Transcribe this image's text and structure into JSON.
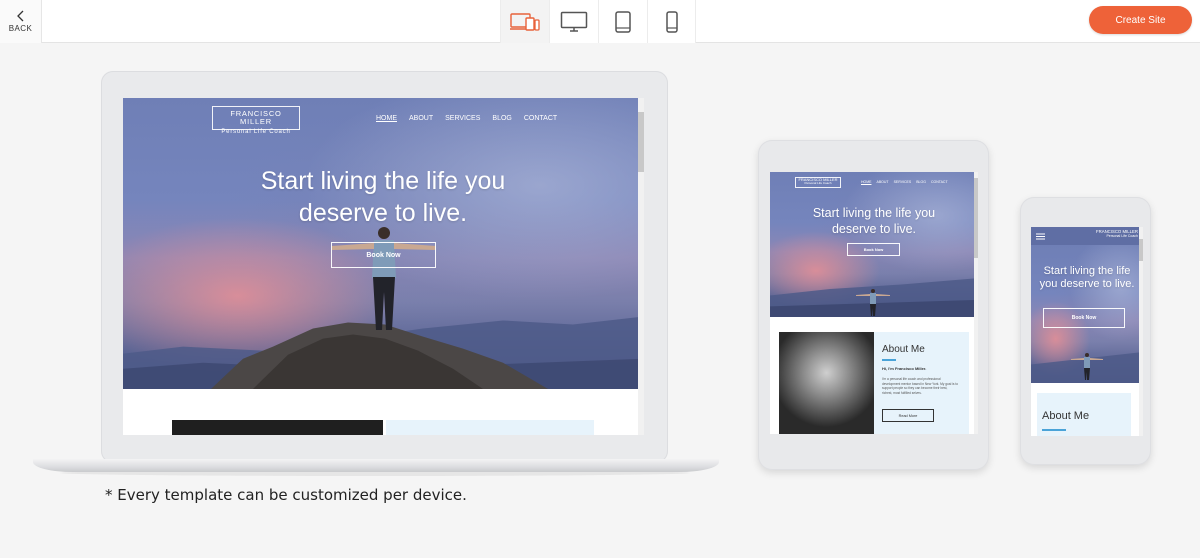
{
  "topbar": {
    "back_label": "BACK",
    "create_label": "Create Site",
    "accent_color": "#ee6239",
    "device_buttons": [
      {
        "name": "all-devices",
        "icon": "multi-device-icon",
        "active": true
      },
      {
        "name": "desktop",
        "icon": "desktop-icon",
        "active": false
      },
      {
        "name": "tablet",
        "icon": "tablet-icon",
        "active": false
      },
      {
        "name": "phone",
        "icon": "phone-icon",
        "active": false
      }
    ]
  },
  "site": {
    "brand_name": "FRANCISCO MILLER",
    "brand_tagline": "Personal Life Coach",
    "nav": [
      "HOME",
      "ABOUT",
      "SERVICES",
      "BLOG",
      "CONTACT"
    ],
    "headline": "Start living the life you deserve to live.",
    "cta_label": "Book Now",
    "about_title": "About Me",
    "about_greeting": "Hi, I'm Francisco Miller.",
    "about_body": "I'm a personal life coach and professional development mentor based in New York. My goal is to support people so they can become their best, richest, most fulfilled selves.",
    "read_more": "Read More"
  },
  "footnote": "* Every template can be customized per device."
}
